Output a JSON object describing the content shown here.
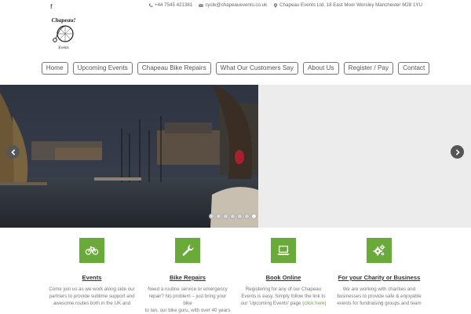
{
  "topbar": {
    "facebook": "f",
    "phone": "+44 7545 421381",
    "email": "cycle@chapeauevents.co.uk",
    "address": "Chapeau Events Ltd, 18 East Moor Worsley Manchester M28 1YU"
  },
  "logo": {
    "title": "Chapeau!",
    "subtitle": "Events"
  },
  "nav": [
    "Home",
    "Upcoming Events",
    "Chapeau Bike Repairs",
    "What Our Customers Say",
    "About Us",
    "Register / Pay",
    "Contact"
  ],
  "slider": {
    "dots": 7,
    "active_dot": 6
  },
  "features": [
    {
      "title": "Events",
      "icon": "bicycle-icon",
      "text_lines": [
        "Come join us as we work along side our",
        "partners to provide sublime support and",
        "awesome routes both in the UK and"
      ]
    },
    {
      "title": "Bike Repairs",
      "icon": "wrench-icon",
      "text_lines": [
        "Need a routine service or emergency",
        "repair? No problem – just bring your bike",
        "to Ian, our bike guru, with over 40 years"
      ]
    },
    {
      "title": "Book Online",
      "icon": "laptop-icon",
      "text_lines": [
        "Registering for any of our Chapeau",
        "Events is easy. Simply follow the link to",
        "our 'Upcoming Events' page ("
      ],
      "link": "click here",
      "after_link": ")"
    },
    {
      "title": "For your Charity or Business",
      "icon": "gears-icon",
      "text_lines": [
        "We are working with charities and",
        "businesses to provide safe & enjoyable",
        "events for fundraising groups and team"
      ]
    }
  ],
  "colors": {
    "accent": "#6aaa3a",
    "nav_border": "#777777",
    "arrow": "#555555"
  }
}
